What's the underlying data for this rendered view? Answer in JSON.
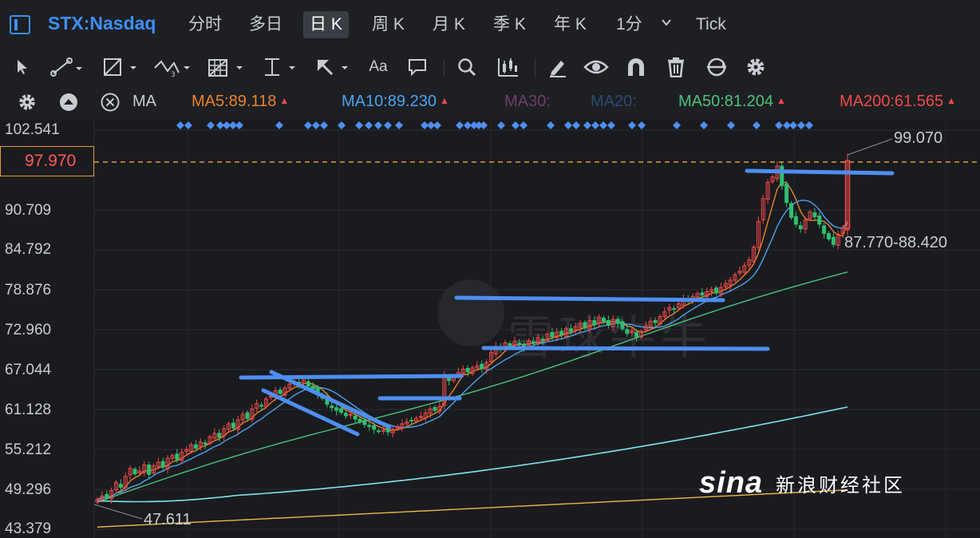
{
  "header": {
    "symbol": "STX:Nasdaq",
    "tabs": [
      {
        "label": "分时"
      },
      {
        "label": "多日"
      },
      {
        "label": "日 K"
      },
      {
        "label": "周 K"
      },
      {
        "label": "月 K"
      },
      {
        "label": "季 K"
      },
      {
        "label": "年 K"
      },
      {
        "label": "1分"
      },
      {
        "label": "Tick"
      }
    ],
    "active_tab": "日 K"
  },
  "toolbar": {
    "font_tool_label": "Aa",
    "icons": [
      "cursor-icon",
      "line-tool-icon",
      "polygon-tool-icon",
      "wave-tool-icon",
      "grid-tool-icon",
      "vertical-line-icon",
      "arrow-tool-icon",
      "text-tool-icon",
      "comment-icon",
      "search-icon",
      "candle-tool-icon",
      "pencil-icon",
      "eye-icon",
      "magnet-icon",
      "trash-icon",
      "sync-icon",
      "gear-icon"
    ]
  },
  "indicators": {
    "type_label": "MA",
    "items": [
      {
        "label": "MA5:89.118",
        "color": "#e8842c",
        "trend": "▲"
      },
      {
        "label": "MA10:89.230",
        "color": "#4aa3f0",
        "trend": "▲"
      },
      {
        "label": "MA30:",
        "color": "#6e3f6a",
        "trend": ""
      },
      {
        "label": "MA20:",
        "color": "#2d4a75",
        "trend": ""
      },
      {
        "label": "MA50:81.204",
        "color": "#4cc27a",
        "trend": "▲"
      },
      {
        "label": "MA200:61.565",
        "color": "#ef4a4a",
        "trend": "▲"
      }
    ]
  },
  "y_axis": {
    "labels": [
      "102.541",
      "90.709",
      "84.792",
      "78.876",
      "72.960",
      "67.044",
      "61.128",
      "55.212",
      "49.296",
      "43.379"
    ],
    "current_price": "97.970"
  },
  "annotations": {
    "high": "99.070",
    "last_range": "87.770-88.420",
    "low": "47.611"
  },
  "watermark": {
    "text": "雪球牛牛"
  },
  "logo": {
    "word": "sina",
    "cn": "新浪财经社区"
  },
  "colors": {
    "up": "#ef4a4a",
    "down": "#2fbf71",
    "accent": "#3d8ff5",
    "current_line": "#e59a3c"
  },
  "chart_data": {
    "type": "candlestick",
    "ylim": [
      43.379,
      102.541
    ],
    "closes": [
      47.8,
      48.3,
      48.0,
      49.1,
      50.3,
      49.6,
      51.2,
      52.4,
      51.6,
      52.0,
      52.9,
      51.5,
      52.8,
      53.3,
      52.6,
      53.9,
      54.3,
      53.7,
      54.8,
      55.2,
      55.9,
      55.4,
      56.3,
      56.0,
      57.1,
      57.6,
      57.0,
      58.3,
      59.0,
      58.4,
      59.6,
      60.4,
      59.8,
      61.2,
      62.0,
      61.6,
      62.7,
      63.1,
      63.9,
      63.5,
      64.3,
      64.9,
      65.3,
      64.9,
      65.5,
      64.6,
      64.1,
      63.4,
      62.8,
      61.9,
      61.4,
      61.0,
      60.7,
      60.2,
      60.4,
      59.7,
      59.3,
      58.9,
      58.6,
      58.2,
      57.9,
      58.1,
      57.8,
      58.2,
      58.6,
      59.0,
      59.3,
      59.5,
      59.8,
      60.1,
      60.6,
      61.2,
      61.0,
      61.6,
      66.2,
      65.4,
      66.0,
      66.6,
      67.1,
      66.7,
      67.3,
      67.6,
      67.2,
      68.1,
      69.6,
      70.4,
      70.1,
      71.0,
      70.6,
      71.2,
      70.8,
      70.4,
      71.3,
      71.0,
      71.8,
      71.4,
      72.3,
      71.9,
      72.6,
      72.2,
      73.1,
      72.7,
      73.4,
      73.9,
      73.2,
      74.3,
      73.7,
      74.8,
      74.2,
      73.6,
      74.5,
      73.9,
      73.1,
      72.4,
      72.8,
      71.9,
      72.7,
      73.5,
      74.2,
      74.0,
      74.9,
      75.6,
      76.2,
      76.0,
      76.8,
      77.5,
      77.2,
      77.9,
      78.3,
      78.1,
      78.6,
      78.9,
      78.4,
      79.2,
      79.8,
      80.3,
      81.1,
      81.6,
      82.4,
      83.3,
      85.2,
      89.0,
      92.4,
      94.8,
      95.6,
      97.2,
      94.3,
      91.8,
      89.6,
      88.6,
      87.9,
      89.2,
      90.4,
      89.7,
      88.6,
      87.2,
      86.4,
      85.6,
      87.1,
      88.0,
      98.0
    ],
    "ma_lines": [
      {
        "name": "MA5",
        "color": "#e8842c"
      },
      {
        "name": "MA10",
        "color": "#4aa3f0"
      },
      {
        "name": "MA50",
        "color": "#4cc27a"
      },
      {
        "name": "MA200",
        "color": "#ef4a4a"
      }
    ]
  }
}
